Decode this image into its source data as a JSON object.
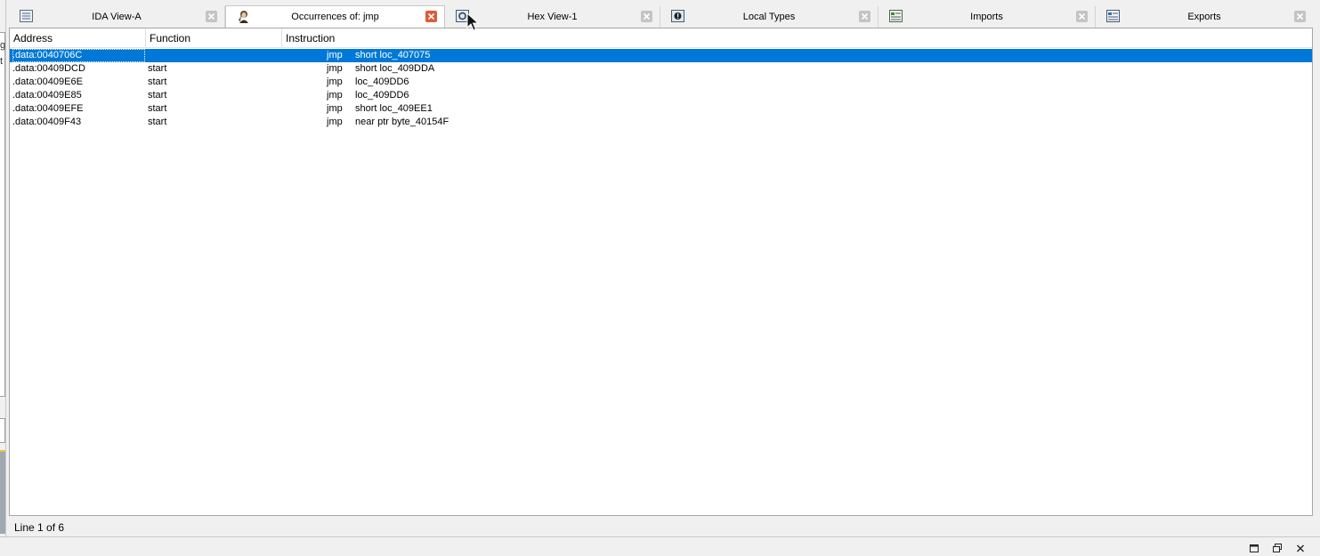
{
  "tabs": [
    {
      "label": "IDA View-A",
      "icon": "ida-view-icon",
      "active": false
    },
    {
      "label": "Occurrences of: jmp",
      "icon": "occurrences-icon",
      "active": true
    },
    {
      "label": "Hex View-1",
      "icon": "hex-view-icon",
      "active": false
    },
    {
      "label": "Local Types",
      "icon": "local-types-icon",
      "active": false
    },
    {
      "label": "Imports",
      "icon": "imports-icon",
      "active": false
    },
    {
      "label": "Exports",
      "icon": "exports-icon",
      "active": false
    }
  ],
  "table": {
    "columns": [
      "Address",
      "Function",
      "Instruction"
    ],
    "rows": [
      {
        "address": ".data:0040706C",
        "function": "",
        "mnemonic": "jmp",
        "operands": "short loc_407075",
        "selected": true
      },
      {
        "address": ".data:00409DCD",
        "function": "start",
        "mnemonic": "jmp",
        "operands": "short loc_409DDA",
        "selected": false
      },
      {
        "address": ".data:00409E6E",
        "function": "start",
        "mnemonic": "jmp",
        "operands": "loc_409DD6",
        "selected": false
      },
      {
        "address": ".data:00409E85",
        "function": "start",
        "mnemonic": "jmp",
        "operands": "loc_409DD6",
        "selected": false
      },
      {
        "address": ".data:00409EFE",
        "function": "start",
        "mnemonic": "jmp",
        "operands": "short loc_409EE1",
        "selected": false
      },
      {
        "address": ".data:00409F43",
        "function": "start",
        "mnemonic": "jmp",
        "operands": "near ptr byte_40154F",
        "selected": false
      }
    ]
  },
  "status": {
    "text": "Line 1 of 6"
  },
  "left_fragment": {
    "glyph1": "g",
    "glyph2": "t"
  },
  "colors": {
    "selection": "#0078d7",
    "active_close": "#e05a3a"
  }
}
